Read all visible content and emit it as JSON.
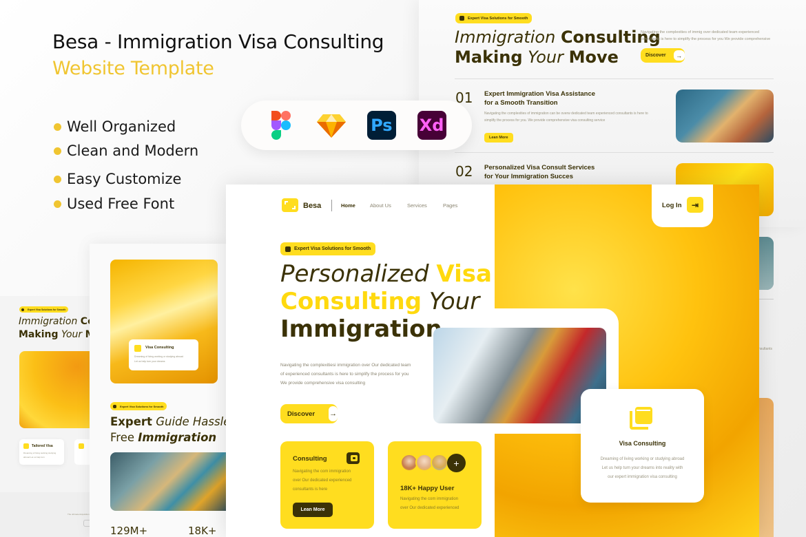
{
  "promo": {
    "title": "Besa - Immigration Visa Consulting",
    "subtitle": "Website Template",
    "features": [
      "Well Organized",
      "Clean and Modern",
      "Easy Customize",
      "Used Free Font"
    ],
    "tools": [
      {
        "name": "figma-icon",
        "label": ""
      },
      {
        "name": "sketch-icon",
        "label": ""
      },
      {
        "name": "photoshop-icon",
        "label": "Ps"
      },
      {
        "name": "xd-icon",
        "label": "Xd"
      }
    ]
  },
  "colors": {
    "accent": "#ffdd1f",
    "dark": "#3b3207",
    "promo_yellow": "#f0c531"
  },
  "top_right_screen": {
    "badge": "Expert Visa Solutions for Smooth",
    "heading_italic_1": "Immigration",
    "heading_bold_1": "Consulting",
    "heading_bold_2": "Making",
    "heading_italic_2": "Your",
    "heading_bold_3": "Move",
    "description": "Navigating the complexities of immig over dedicated team experienced consultants is here to simplify the process for you We provide comprehensive",
    "discover_label": "Discover",
    "items": [
      {
        "num": "01",
        "title_1": "Expert Immigration Visa Assistance",
        "title_2": "for a Smooth Transition",
        "text": "Navigating the complexities of immigration can be overw dedicated team experienced consultants is here to simplify the process for you. We provide comprehensive visa consulting service",
        "button": "Lean More"
      },
      {
        "num": "02",
        "title_1": "Personalized Visa Consult Services",
        "title_2": "for Your Immigration Succes"
      }
    ],
    "side_text": "nsultants"
  },
  "main_screen": {
    "logo": "Besa",
    "nav": [
      "Home",
      "About Us",
      "Services",
      "Pages"
    ],
    "login_label": "Log In",
    "badge": "Expert Visa Solutions for Smooth",
    "hero_line1_italic": "Personalized",
    "hero_line1_yellow": "Visa",
    "hero_line2_yellow": "Consulting",
    "hero_line2_italic": "Your",
    "hero_line3": "Immigration",
    "description_lines": [
      "Navigating the complexitiesi immigration over Our dedicated team",
      "of experienced consultants is here to simplify the process for you",
      "We provide comprehensive visa consulting"
    ],
    "discover_label": "Discover",
    "consulting_card": {
      "title": "Consulting",
      "lines": [
        "Navigating the com immigration",
        "over Our dedicated experienced",
        "consultants is here"
      ],
      "button": "Lean More"
    },
    "users_card": {
      "title": "18K+ Happy User",
      "lines": [
        "Navigating the com immigration",
        "over Our dedicated experienced"
      ]
    },
    "visa_card": {
      "title": "Visa Consulting",
      "lines": [
        "Dreaming of living working or studying abroad",
        "Let us help turn your dreams into reality with",
        "our expert immigration visa consulting"
      ]
    }
  },
  "left_screen_1": {
    "card_title": "Visa Consulting",
    "card_lines": [
      "Dreaming of living working or studying abroad",
      "Let us help turn your dreams"
    ],
    "badge": "Expert Visa Solutions for Smooth",
    "heading_bold_1": "Expert",
    "heading_italic_1": "Guide Hassle",
    "heading_normal_2": "Free",
    "heading_boldital_2": "Immigration",
    "stats": [
      "129M+",
      "18K+"
    ]
  },
  "left_screen_2": {
    "badge": "Expert Visa Solutions for Smooth",
    "heading_italic_1": "Immigration",
    "heading_bold_1": "Co",
    "heading_bold_2": "Making",
    "heading_italic_2": "Your",
    "heading_bold_3": "M",
    "card_title": "Tailored Visa",
    "card_lines": [
      "Dreaming of living working studying",
      "abroad Let us help turn"
    ],
    "footer_text": "The ultimate Acquisition"
  }
}
